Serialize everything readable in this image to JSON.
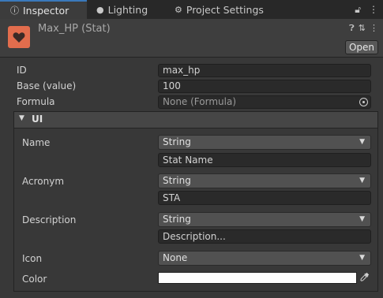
{
  "tabs": [
    {
      "label": "Inspector",
      "icon": "info-icon",
      "active": true
    },
    {
      "label": "Lighting",
      "icon": "lightbulb-icon",
      "active": false
    },
    {
      "label": "Project Settings",
      "icon": "gear-icon",
      "active": false
    }
  ],
  "header": {
    "title": "Max_HP (Stat)",
    "icon": "heart-icon",
    "icon_color": "#e26d4d",
    "open_label": "Open"
  },
  "fields": {
    "id": {
      "label": "ID",
      "value": "max_hp"
    },
    "base": {
      "label": "Base (value)",
      "value": "100"
    },
    "formula": {
      "label": "Formula",
      "value": "None (Formula)"
    }
  },
  "ui": {
    "title": "UI",
    "name": {
      "label": "Name",
      "type": "String",
      "value": "Stat Name"
    },
    "acronym": {
      "label": "Acronym",
      "type": "String",
      "value": "STA"
    },
    "description": {
      "label": "Description",
      "type": "String",
      "value": "Description..."
    },
    "icon": {
      "label": "Icon",
      "type": "None"
    },
    "color": {
      "label": "Color",
      "value": "#ffffff"
    }
  },
  "colors": {
    "accent": "#3a79bb",
    "background": "#383838"
  }
}
